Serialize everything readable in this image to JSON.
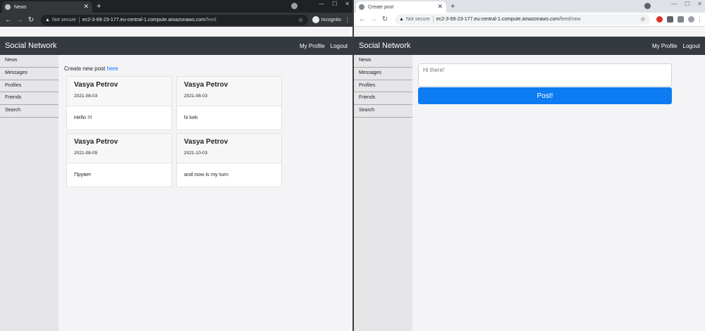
{
  "left_window": {
    "tab_title": "News",
    "omnibox": {
      "security": "Not secure",
      "host": "ec2-3-69-23-177.eu-central-1.compute.amazonaws.com",
      "path": "/feed"
    },
    "profile_label": "Incognito",
    "site": {
      "brand": "Social Network",
      "nav": [
        "My Profile",
        "Logout"
      ],
      "sidebar": [
        "News",
        "Messages",
        "Profiles",
        "Friends",
        "Search"
      ],
      "create_text": "Create new post",
      "create_link": "here",
      "posts": [
        {
          "author": "Vasya Petrov",
          "date": "2021-08-03",
          "text": "Hello !!!"
        },
        {
          "author": "Vasya Petrov",
          "date": "2021-08-03",
          "text": "hi kek"
        },
        {
          "author": "Vasya Petrov",
          "date": "2021-08-05",
          "text": "Прувет"
        },
        {
          "author": "Vasya Petrov",
          "date": "2021-10-03",
          "text": "and now is my turn"
        }
      ]
    }
  },
  "right_window": {
    "tab_title": "Create post",
    "omnibox": {
      "security": "Not secure",
      "host": "ec2-3-69-23-177.eu-central-1.compute.amazonaws.com",
      "path": "/feed/new"
    },
    "site": {
      "brand": "Social Network",
      "nav": [
        "My Profile",
        "Logout"
      ],
      "sidebar": [
        "News",
        "Messages",
        "Profiles",
        "Friends",
        "Search"
      ],
      "post_placeholder": "Hi there!",
      "post_button": "Post!"
    }
  },
  "icons": {
    "tab_close": "✕",
    "new_tab": "+",
    "back": "←",
    "forward": "→",
    "reload": "↻",
    "warning": "▲",
    "star": "☆",
    "menu": "⋮",
    "minimize": "—",
    "maximize": "☐",
    "close": "✕"
  }
}
